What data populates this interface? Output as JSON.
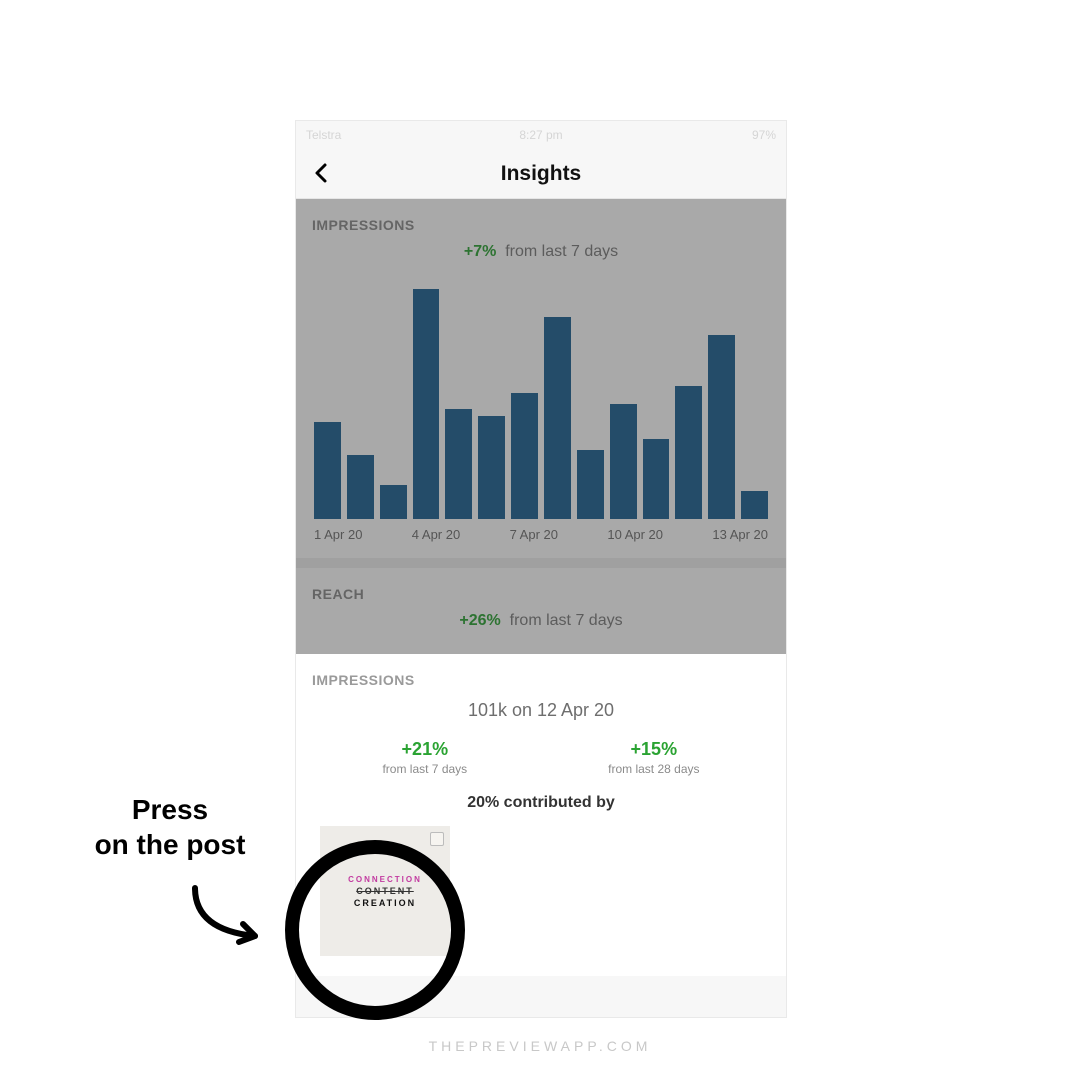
{
  "statusbar": {
    "carrier": "Telstra",
    "signal": "●●",
    "time": "8:27 pm",
    "battery": "97%"
  },
  "nav": {
    "title": "Insights"
  },
  "impressions_top": {
    "label": "IMPRESSIONS",
    "delta": "+7%",
    "delta_sub": "from last 7 days"
  },
  "reach": {
    "label": "REACH",
    "delta": "+26%",
    "delta_sub": "from last 7 days"
  },
  "detail": {
    "label": "IMPRESSIONS",
    "headline": "101k on 12 Apr 20",
    "stat1_delta": "+21%",
    "stat1_sub": "from last 7 days",
    "stat2_delta": "+15%",
    "stat2_sub": "from last 28 days",
    "contrib": "20% contributed by"
  },
  "post": {
    "line1": "CONNECTION",
    "line2": "CONTENT",
    "line3": "CREATION"
  },
  "annotation": {
    "text": "Press\non the post"
  },
  "watermark": "THEPREVIEWAPP.COM",
  "chart_data": {
    "type": "bar",
    "title": "IMPRESSIONS",
    "xlabel": "",
    "ylabel": "",
    "categories": [
      "1 Apr 20",
      "2 Apr 20",
      "3 Apr 20",
      "4 Apr 20",
      "5 Apr 20",
      "6 Apr 20",
      "7 Apr 20",
      "8 Apr 20",
      "9 Apr 20",
      "10 Apr 20",
      "11 Apr 20",
      "12 Apr 20",
      "13 Apr 20",
      "14 Apr 20"
    ],
    "values": [
      42,
      28,
      15,
      100,
      48,
      45,
      55,
      88,
      30,
      50,
      35,
      58,
      80,
      12
    ],
    "x_ticks_shown": [
      "1 Apr 20",
      "4 Apr 20",
      "7 Apr 20",
      "10 Apr 20",
      "13 Apr 20"
    ]
  }
}
